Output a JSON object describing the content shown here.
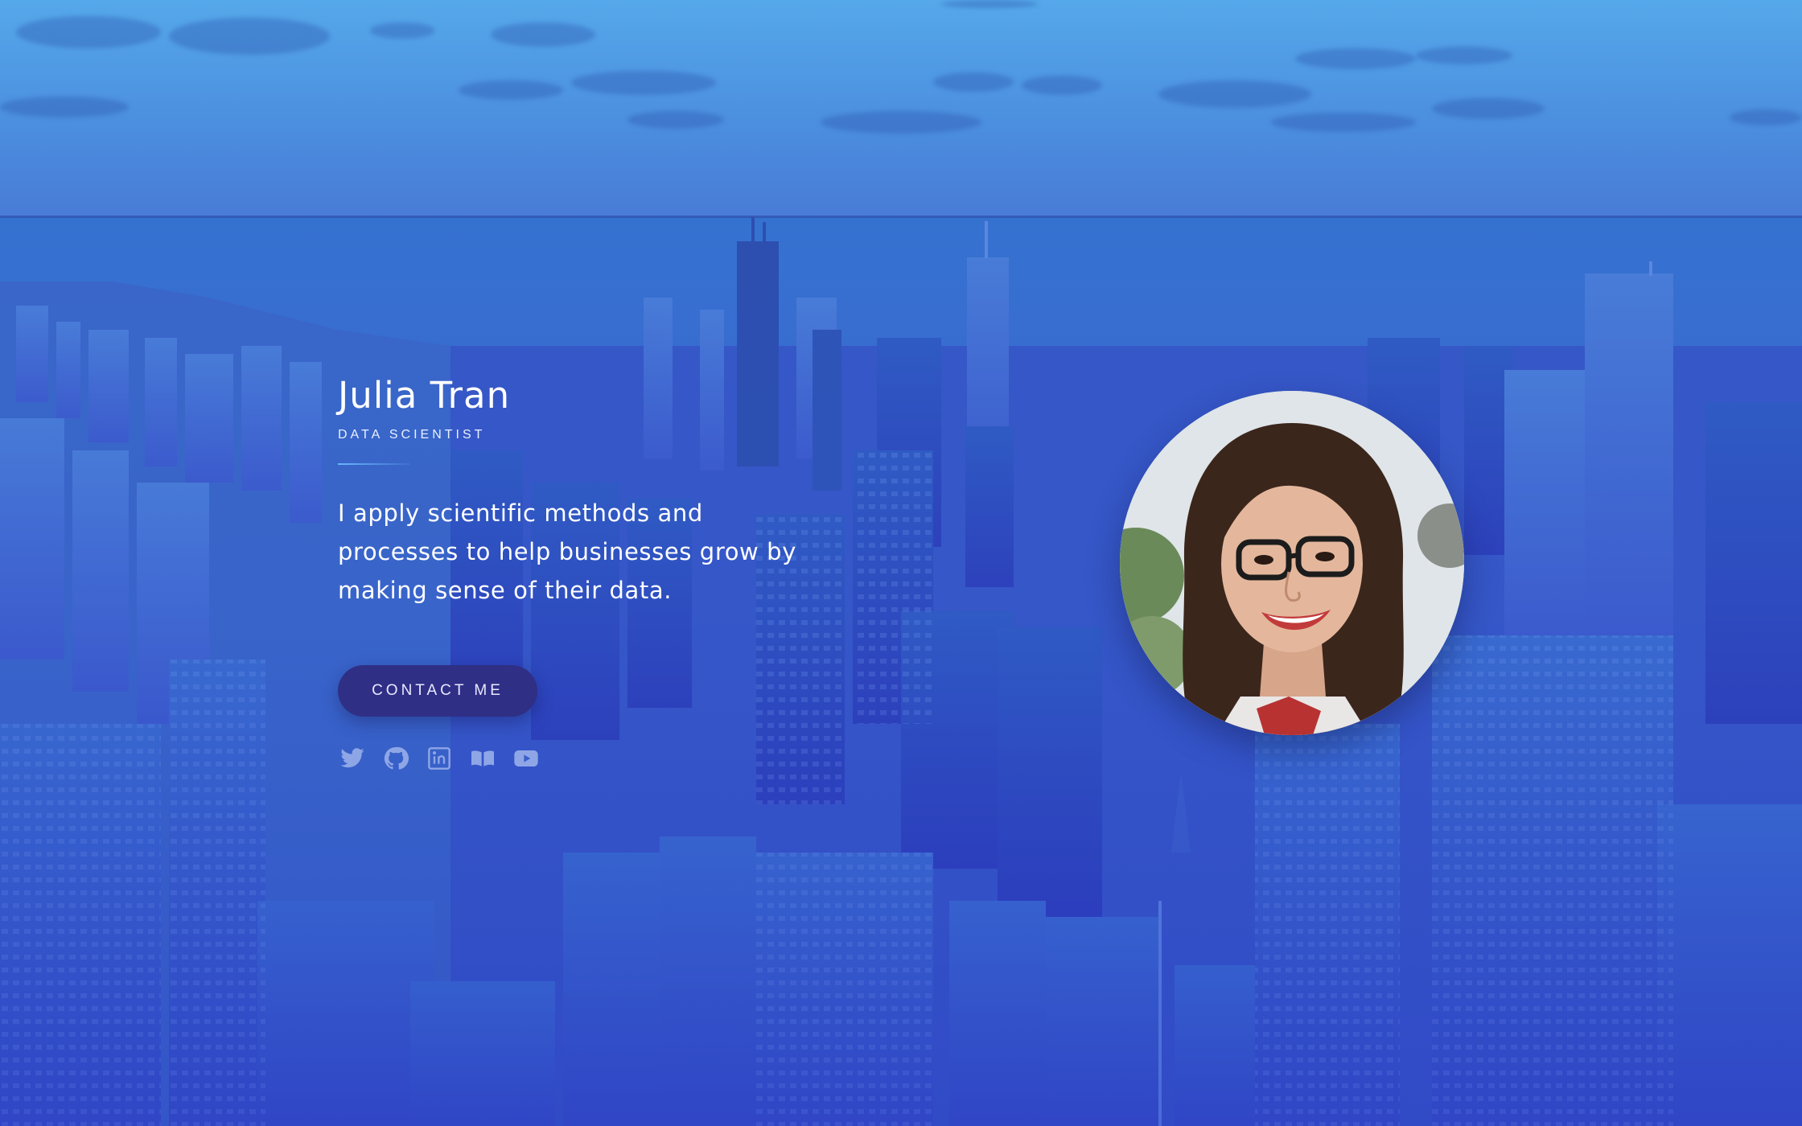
{
  "profile": {
    "name": "Julia Tran",
    "role": "DATA SCIENTIST",
    "bio": "I apply scientific methods and processes to help businesses grow by making sense of their data.",
    "contact_label": "CONTACT ME"
  },
  "socials": [
    {
      "icon": "twitter-icon"
    },
    {
      "icon": "github-icon"
    },
    {
      "icon": "linkedin-icon"
    },
    {
      "icon": "book-icon"
    },
    {
      "icon": "youtube-icon"
    }
  ],
  "colors": {
    "accent": "#2f2f86",
    "icon": "#8fa6e6"
  }
}
